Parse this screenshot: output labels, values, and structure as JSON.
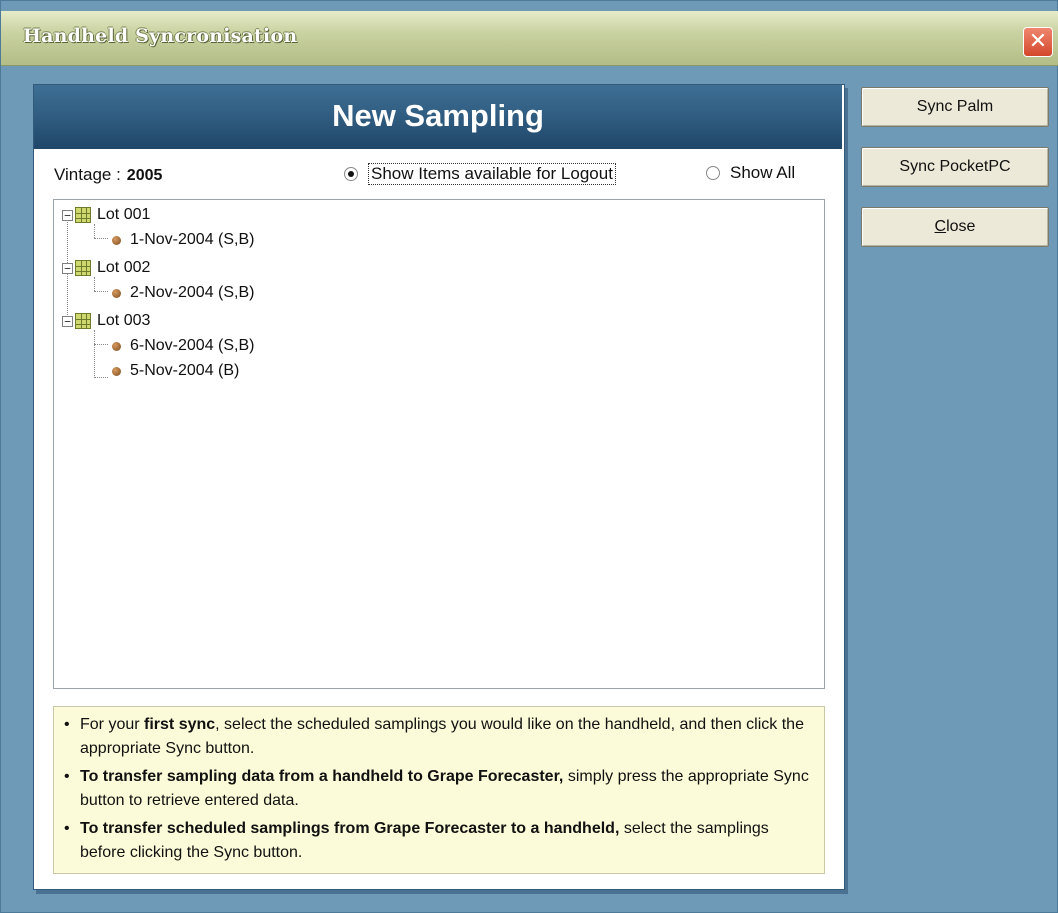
{
  "window": {
    "title": "Handheld Syncronisation",
    "close_glyph": "✕"
  },
  "panel": {
    "title": "New Sampling"
  },
  "vintage": {
    "label": "Vintage :",
    "value": "2005"
  },
  "filter": {
    "option_logout": "Show Items available for Logout",
    "option_all": "Show All",
    "selected": "logout"
  },
  "tree": {
    "lots": [
      {
        "label": "Lot 001",
        "samplings": [
          "1-Nov-2004 (S,B)"
        ]
      },
      {
        "label": "Lot 002",
        "samplings": [
          "2-Nov-2004 (S,B)"
        ]
      },
      {
        "label": "Lot 003",
        "samplings": [
          "6-Nov-2004 (S,B)",
          "5-Nov-2004 (B)"
        ]
      }
    ]
  },
  "info": [
    {
      "bold": "",
      "pre": "For your ",
      "mid_bold": "first sync",
      "post": ", select the scheduled samplings you would like on the handheld, and then click the appropriate Sync button."
    },
    {
      "bold": "To transfer sampling data from a handheld to Grape Forecaster,",
      "post": " simply press the appropriate Sync button to retrieve entered data."
    },
    {
      "bold": "To transfer scheduled samplings from Grape Forecaster to a handheld,",
      "post": " select the samplings before clicking the Sync button."
    }
  ],
  "buttons": {
    "sync_palm": "Sync Palm",
    "sync_pocketpc": "Sync PocketPC",
    "close_mnemonic": "C",
    "close_rest": "lose"
  },
  "colors": {
    "header": "#2e5a7e",
    "background": "#6e9ab8",
    "info_bg": "#fbfbd9"
  }
}
